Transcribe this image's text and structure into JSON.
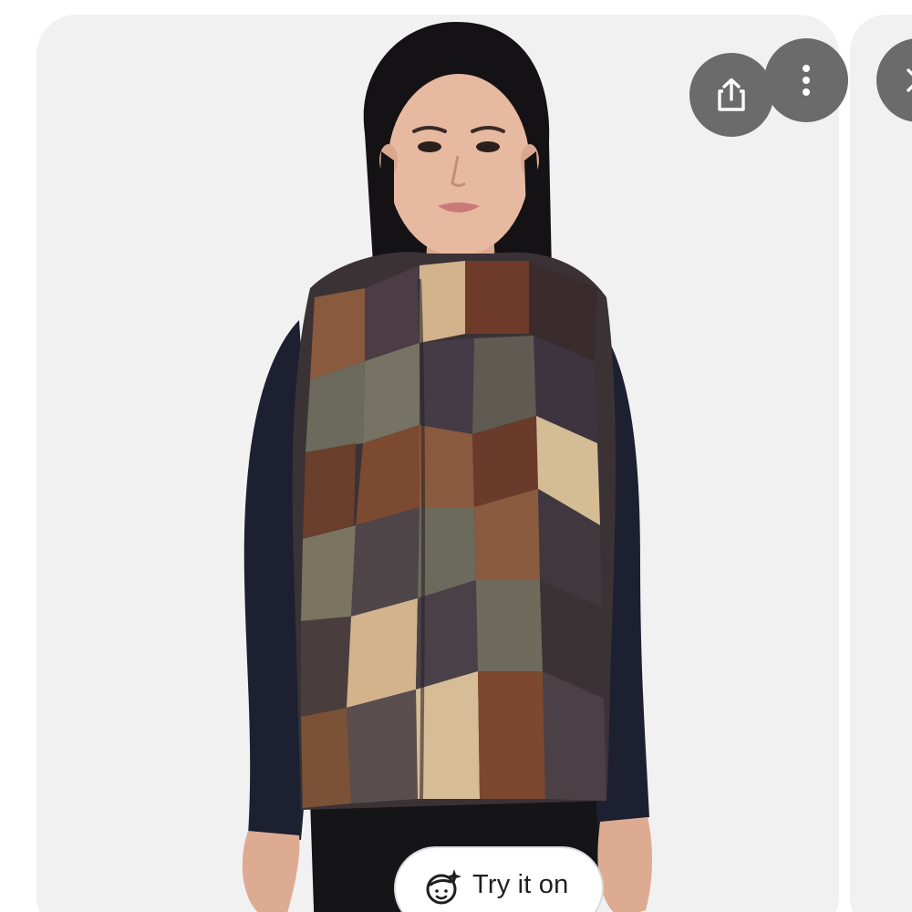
{
  "actions": {
    "share_icon": "share-icon",
    "more_icon": "more-vertical-icon",
    "close_icon": "close-icon"
  },
  "try_on": {
    "label": "Try it on",
    "icon": "face-sparkle-icon"
  },
  "colors": {
    "card_background": "#f1f1f1",
    "action_button": "#6b6b6b",
    "pill_border": "#d9dce1"
  }
}
